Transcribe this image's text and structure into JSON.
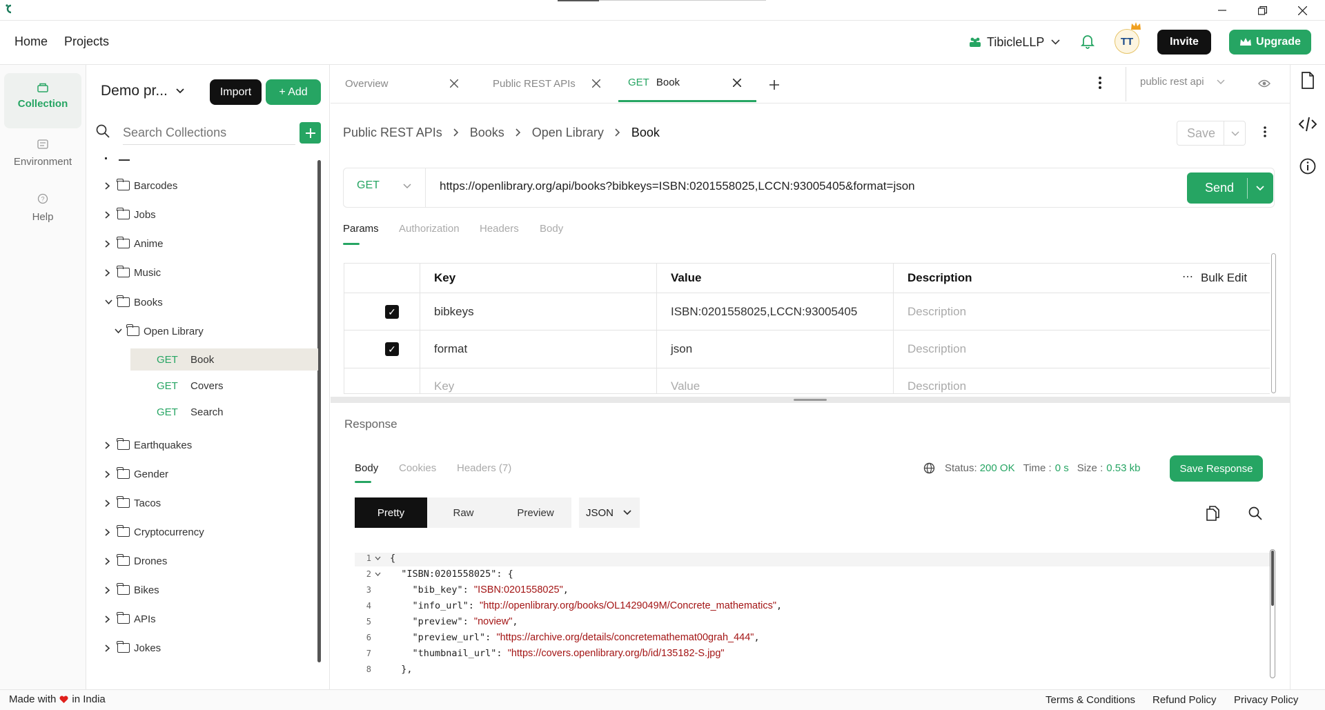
{
  "app": {
    "colors": {
      "accent": "#26a563",
      "dark": "#111111",
      "method": "#26a563",
      "string": "#a31515"
    }
  },
  "topnav": {
    "home": "Home",
    "projects": "Projects",
    "workspace": "TibicleLLP",
    "avatar": "TT",
    "invite": "Invite",
    "upgrade": "Upgrade"
  },
  "rail": {
    "collection": "Collection",
    "environment": "Environment",
    "help": "Help"
  },
  "sidebar": {
    "project": "Demo pr...",
    "import": "Import",
    "add": "+ Add",
    "search_placeholder": "Search Collections",
    "folders_top": [
      "Barcodes",
      "Jobs",
      "Anime",
      "Music"
    ],
    "books": "Books",
    "open_library": "Open Library",
    "requests": [
      {
        "method": "GET",
        "name": "Book"
      },
      {
        "method": "GET",
        "name": "Covers"
      },
      {
        "method": "GET",
        "name": "Search"
      }
    ],
    "folders_bottom": [
      "Earthquakes",
      "Gender",
      "Tacos",
      "Cryptocurrency",
      "Drones",
      "Bikes",
      "APIs",
      "Jokes"
    ]
  },
  "tabs": {
    "overview": "Overview",
    "public": "Public REST APIs",
    "active_method": "GET",
    "active_name": "Book",
    "env": "public rest api"
  },
  "request": {
    "breadcrumb": [
      "Public REST APIs",
      "Books",
      "Open Library",
      "Book"
    ],
    "save": "Save",
    "method": "GET",
    "url": "https://openlibrary.org/api/books?bibkeys=ISBN:0201558025,LCCN:93005405&format=json",
    "send": "Send",
    "subtabs": [
      "Params",
      "Authorization",
      "Headers",
      "Body"
    ]
  },
  "params": {
    "headers": {
      "key": "Key",
      "value": "Value",
      "description": "Description",
      "bulk": "Bulk Edit"
    },
    "rows": [
      {
        "key": "bibkeys",
        "value": "ISBN:0201558025,LCCN:93005405",
        "description": "Description"
      },
      {
        "key": "format",
        "value": "json",
        "description": "Description"
      }
    ],
    "empty": {
      "key": "Key",
      "value": "Value",
      "description": "Description"
    }
  },
  "response": {
    "title": "Response",
    "tabs": [
      "Body",
      "Cookies",
      "Headers (7)"
    ],
    "status_label": "Status:",
    "status": "200 OK",
    "time_label": "Time :",
    "time": "0 s",
    "size_label": "Size :",
    "size": "0.53 kb",
    "save": "Save Response",
    "views": [
      "Pretty",
      "Raw",
      "Preview"
    ],
    "format": "JSON",
    "lines": [
      {
        "n": "1",
        "pre": "{",
        "str": "",
        "post": ""
      },
      {
        "n": "2",
        "pre": "  \"ISBN:0201558025\": {",
        "str": "",
        "post": ""
      },
      {
        "n": "3",
        "pre": "    \"bib_key\": ",
        "str": "\"ISBN:0201558025\"",
        "post": ","
      },
      {
        "n": "4",
        "pre": "    \"info_url\": ",
        "str": "\"http://openlibrary.org/books/OL1429049M/Concrete_mathematics\"",
        "post": ","
      },
      {
        "n": "5",
        "pre": "    \"preview\": ",
        "str": "\"noview\"",
        "post": ","
      },
      {
        "n": "6",
        "pre": "    \"preview_url\": ",
        "str": "\"https://archive.org/details/concretemathemat00grah_444\"",
        "post": ","
      },
      {
        "n": "7",
        "pre": "    \"thumbnail_url\": ",
        "str": "\"https://covers.openlibrary.org/b/id/135182-S.jpg\"",
        "post": ""
      },
      {
        "n": "8",
        "pre": "  },",
        "str": "",
        "post": ""
      }
    ]
  },
  "footer": {
    "made_prefix": "Made with",
    "made_suffix": "in India",
    "terms": "Terms & Conditions",
    "refund": "Refund Policy",
    "privacy": "Privacy Policy"
  }
}
